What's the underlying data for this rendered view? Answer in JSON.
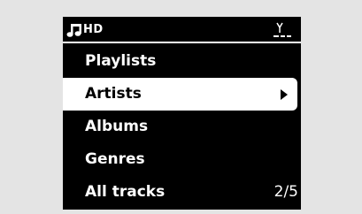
{
  "status": {
    "source": "HD",
    "source_icon": "music-note-icon",
    "signal_icon": "antenna-signal-icon"
  },
  "menu": {
    "items": [
      {
        "label": "Playlists",
        "selected": false
      },
      {
        "label": "Artists",
        "selected": true
      },
      {
        "label": "Albums",
        "selected": false
      },
      {
        "label": "Genres",
        "selected": false
      },
      {
        "label": "All tracks",
        "selected": false
      }
    ],
    "position": "2/5"
  },
  "colors": {
    "screen_background": "#000000",
    "text": "#ffffff",
    "highlight": "#ffffff",
    "highlight_text": "#000000",
    "page_background": "#e4e4e4"
  }
}
